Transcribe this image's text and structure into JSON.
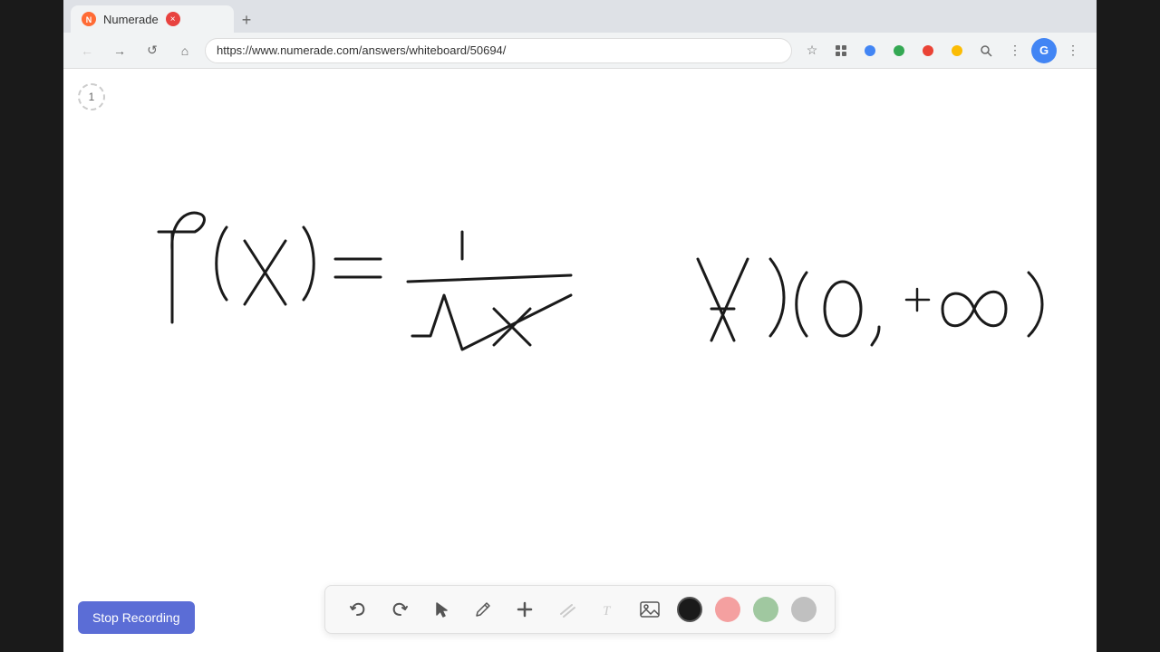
{
  "browser": {
    "tab_title": "Numerade",
    "tab_favicon": "N",
    "url": "https://www.numerade.com/answers/whiteboard/50694/",
    "new_tab_label": "+"
  },
  "nav": {
    "back_icon": "←",
    "forward_icon": "→",
    "refresh_icon": "↺",
    "home_icon": "⌂"
  },
  "browser_actions": {
    "bookmark_icon": "☆",
    "extensions_icon": "⚙",
    "menu_icon": "⋮"
  },
  "page": {
    "number": "1"
  },
  "toolbar": {
    "undo_label": "↺",
    "redo_label": "↻",
    "select_label": "▶",
    "pen_label": "✏",
    "plus_label": "+",
    "eraser_label": "/",
    "text_label": "T",
    "image_label": "🖼",
    "colors": [
      {
        "value": "#1a1a1a",
        "name": "black"
      },
      {
        "value": "#f4a0a0",
        "name": "pink"
      },
      {
        "value": "#a0c8a0",
        "name": "green"
      },
      {
        "value": "#c0c0c0",
        "name": "gray"
      }
    ]
  },
  "recording": {
    "button_label": "Stop Recording"
  }
}
